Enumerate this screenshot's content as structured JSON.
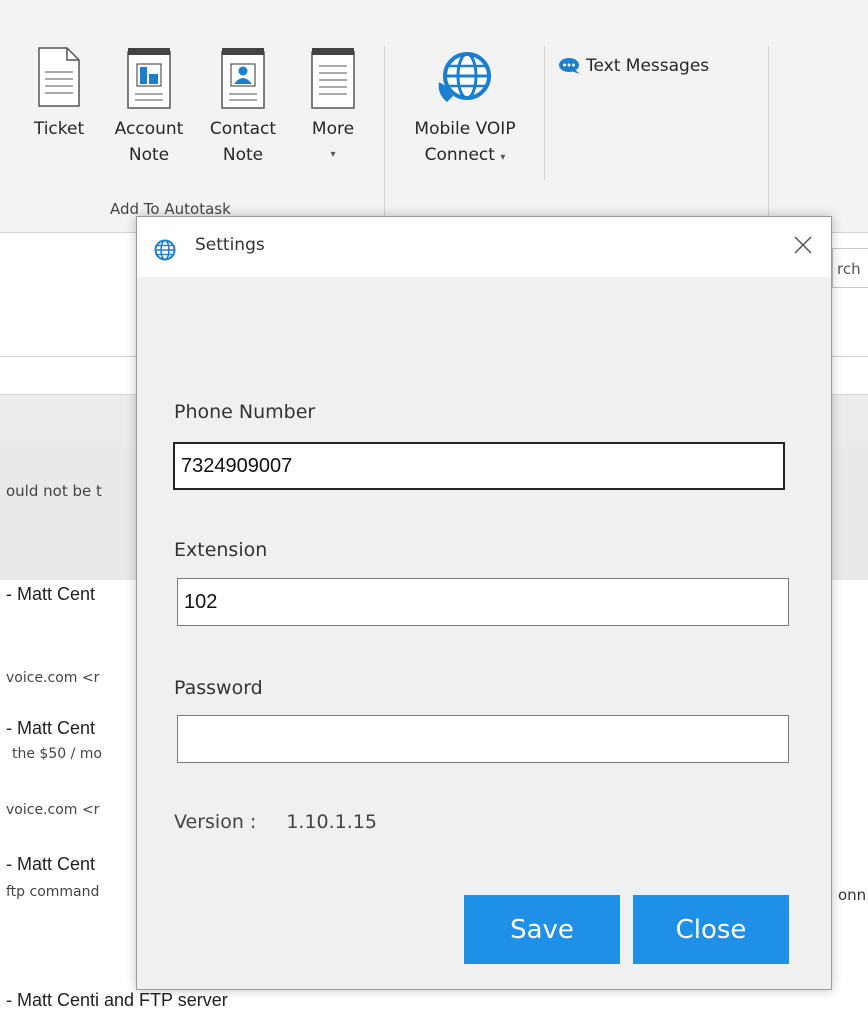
{
  "ribbon": {
    "buttons": [
      {
        "line1": "Ticket",
        "line2": "",
        "icon": "document-icon"
      },
      {
        "line1": "Account",
        "line2": "Note",
        "icon": "building-note-icon"
      },
      {
        "line1": "Contact",
        "line2": "Note",
        "icon": "contact-note-icon"
      },
      {
        "line1": "More",
        "line2": "▾",
        "icon": "notepad-icon"
      },
      {
        "line1": "Mobile VOIP",
        "line2": "Connect",
        "icon": "globe-phone-icon"
      }
    ],
    "group_label": "Add To Autotask",
    "text_messages": "Text Messages"
  },
  "background": {
    "search_fragment": "rch",
    "snippet_1": "ould not be t",
    "row1_sender": "- Matt Cent",
    "row1_email": "voice.com <r",
    "row2_sender": "- Matt Cent",
    "row2_preview": "the $50 / mo",
    "row2_email": "voice.com <r",
    "row3_sender": "- Matt Cent",
    "row3_preview": "ftp command",
    "right_fragment": "onn",
    "row4_sender": "- Matt Centi and FTP server"
  },
  "dialog": {
    "title": "Settings",
    "phone_label": "Phone Number",
    "phone_value": "7324909007",
    "extension_label": "Extension",
    "extension_value": "102",
    "password_label": "Password",
    "password_value": "",
    "version_label": "Version :",
    "version_value": "1.10.1.15",
    "save_label": "Save",
    "close_label": "Close"
  },
  "colors": {
    "accent_button": "#1e90e8",
    "ribbon_bg": "#f3f3f3",
    "dialog_bg": "#f0f0f0"
  }
}
